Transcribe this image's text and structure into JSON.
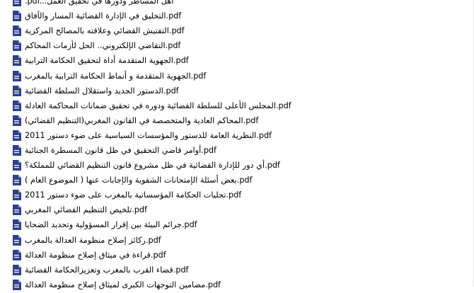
{
  "files": [
    {
      "name": ".pdf...أهل المساطر ودورها في تحقيق العمل"
    },
    {
      "name": "التخليق في الإدارة القضائية المسار والآفاق.pdf"
    },
    {
      "name": "التفتيش القضائي وعلاقته بالمصالح المركزية.pdf"
    },
    {
      "name": "التقاضي الإلكتروني.. الحل لأزمات المحاكم.pdf"
    },
    {
      "name": "الجهوية المتقدمة أداة لتحقيق الحكامة الترابية.pdf"
    },
    {
      "name": "الجهوية المتقدمة و أنماط الحكامة الترابية بالمغرب.pdf"
    },
    {
      "name": "الدستور الجديد واستقلال السلطة القضائية.pdf"
    },
    {
      "name": "المجلس الأعلى للسلطة القضائية ودوره في تحقيق ضمانات المحاكمة العادلة.pdf"
    },
    {
      "name": "المحاكم العادية والمتخصصة في القانون المغربي(التنظيم القضائي).pdf"
    },
    {
      "name": "النظرية العامة للدستور والمؤسسات السياسية على ضوء دستور 2011.pdf"
    },
    {
      "name": "أوامر قاضي التحقيق في ظل قانون المسطرة الجنائية.pdf"
    },
    {
      "name": "أي دور للإدارة القضائية في ظل مشروع قانون التنظيم القضائي للمملكة؟.pdf"
    },
    {
      "name": "بعض أسئلة الإمتحانات الشفوية والإجابات عنها ( الموضوع العام ).pdf"
    },
    {
      "name": "تجليات الحكامة المؤسساتية بالمغرب على ضوء دستور 2011.pdf"
    },
    {
      "name": "تلخيص التنظيم القضائي المغربي.pdf"
    },
    {
      "name": "جرائم البيئة بين إقرار المسؤولية وتحديد الضحايا.pdf"
    },
    {
      "name": "ركائز إصلاح منظومة العدالة بالمغرب.pdf"
    },
    {
      "name": "قراءة في ميثاق إصلاح منظومة العدالة.pdf"
    },
    {
      "name": "قضاء القرب بالمغرب وتعزيزالحكامة القضائية.pdf"
    },
    {
      "name": "مضامين التوجهات الكبرى لميثاق إصلاح منظومة العدالة.pdf"
    }
  ],
  "icon": "pdf-file-icon",
  "colors": {
    "icon_body": "#2f3f8f",
    "icon_fold": "#8ea0d8",
    "text": "#000000"
  }
}
